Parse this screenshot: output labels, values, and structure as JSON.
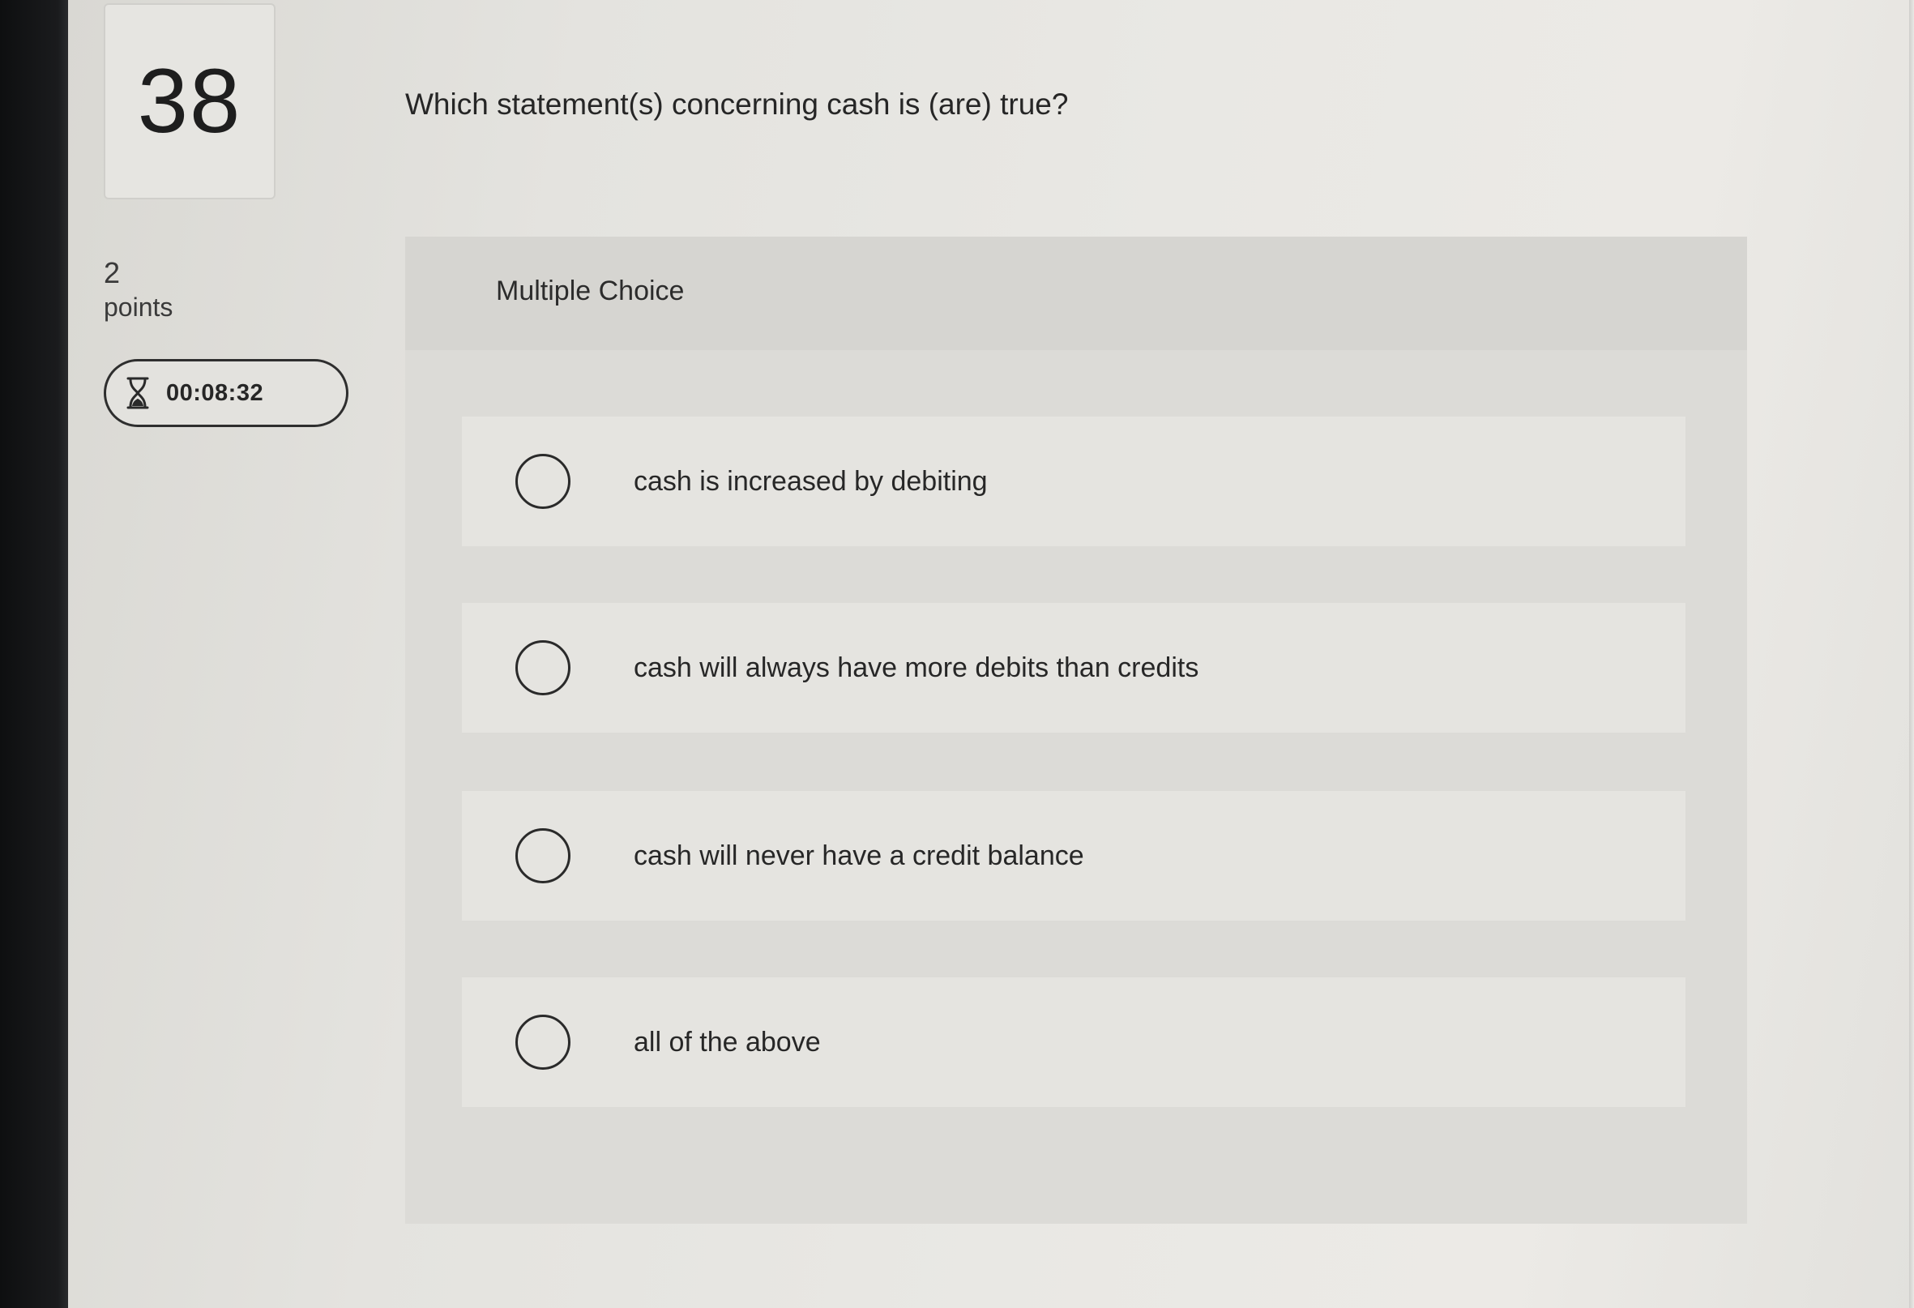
{
  "question": {
    "number": "38",
    "text": "Which statement(s) concerning cash is (are) true?",
    "points_value": "2",
    "points_label": "points",
    "timer": "00:08:32",
    "timer_icon": "hourglass-icon"
  },
  "answer_panel": {
    "title": "Multiple Choice",
    "options": [
      {
        "label": "cash is increased by debiting",
        "selected": false
      },
      {
        "label": "cash will always have more debits than credits",
        "selected": false
      },
      {
        "label": "cash will never have a credit balance",
        "selected": false
      },
      {
        "label": "all of the above",
        "selected": false
      }
    ]
  },
  "colors": {
    "page_background": "#e7e6e2",
    "panel_background": "#dcdbd7",
    "option_background": "#e5e4e0",
    "text": "#262626"
  }
}
